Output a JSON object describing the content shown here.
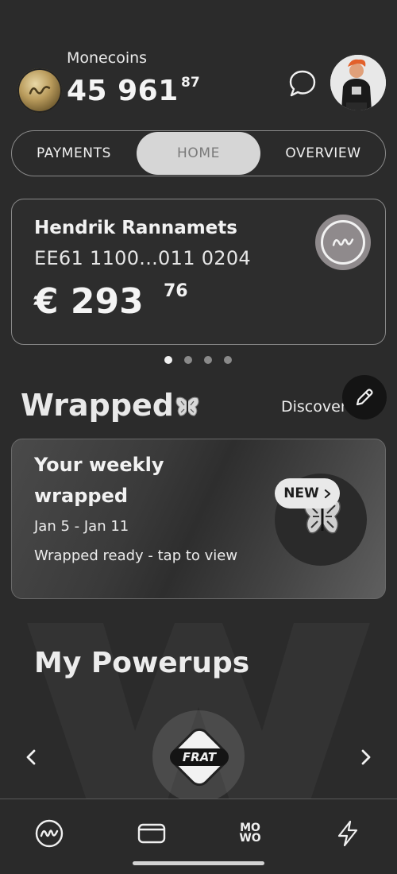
{
  "header": {
    "coins_label": "Monecoins",
    "coins_value": "45 961",
    "coins_cents": "87",
    "icons": [
      "coin-logo-icon",
      "chat-bubble-icon",
      "profile-avatar"
    ]
  },
  "tabs": [
    {
      "label": "PAYMENTS",
      "active": false
    },
    {
      "label": "HOME",
      "active": true
    },
    {
      "label": "OVERVIEW",
      "active": false
    }
  ],
  "account": {
    "name": "Hendrik Rannamets",
    "iban": "EE61 1100...011 0204",
    "balance": "€ 293",
    "cents": "76",
    "pager": {
      "count": 4,
      "active_index": 0
    }
  },
  "wrapped": {
    "title": "Wrapped",
    "discover_label": "Discover",
    "card_title": "Your weekly wrapped",
    "date_range": "Jan 5 - Jan 11",
    "status": "Wrapped ready - tap to view",
    "badge": "NEW"
  },
  "powerups": {
    "title": "My Powerups",
    "current": "FRAT"
  },
  "bottom_nav": [
    "home-logo-icon",
    "card-icon",
    "mowo-icon",
    "lightning-icon"
  ],
  "nav_text": {
    "mowo_top": "MO",
    "mowo_bottom": "WO"
  },
  "colors": {
    "background": "#2b2b2b",
    "active_tab": "#d6d6d6",
    "card_logo": "#8f8a8c"
  }
}
